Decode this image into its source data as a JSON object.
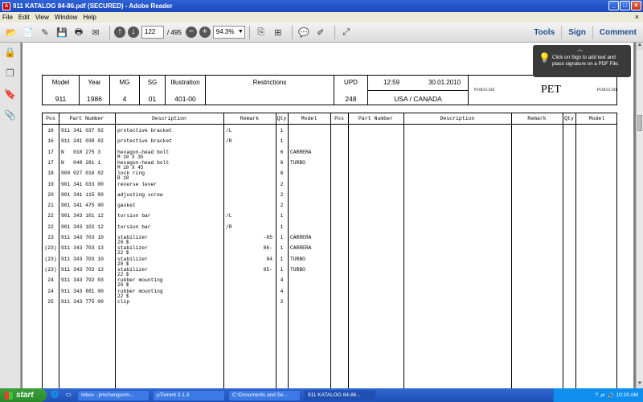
{
  "window": {
    "title": "911 KATALOG 84-86.pdf (SECURED) - Adobe Reader",
    "app_icon_text": "A"
  },
  "menu": [
    "File",
    "Edit",
    "View",
    "Window",
    "Help"
  ],
  "toolbar": {
    "page_current": "122",
    "page_total": "/ 495",
    "zoom": "94.3%",
    "links": [
      "Tools",
      "Sign",
      "Comment"
    ]
  },
  "tooltip": {
    "text": "Click on Sign to add text and place signature on a PDF File."
  },
  "header": {
    "model_label": "Model",
    "model": "911",
    "year_label": "Year",
    "year": "1986",
    "mg_label": "MG",
    "mg": "4",
    "sg_label": "SG",
    "sg": "01",
    "illustration_label": "Illustration",
    "illustration": "401-00",
    "restrictions_label": "Restrictions",
    "upd_label": "UPD",
    "upd": "248",
    "time": "12:59",
    "date": "30.01.2010",
    "market": "USA / CANADA",
    "brand_left": "PORSCHE",
    "brand_center": "PET",
    "brand_right": "PORSCHE"
  },
  "table": {
    "columns": [
      "Pos",
      "Part Number",
      "Description",
      "Remark",
      "Qty",
      "Model"
    ],
    "rows": [
      {
        "pos": "16",
        "part": "911 341 037 02",
        "desc": "protective bracket",
        "sub": "",
        "remark": "/L",
        "qty": "1",
        "model": ""
      },
      {
        "pos": "16",
        "part": "911 341 038 02",
        "desc": "protective bracket",
        "sub": "",
        "remark": "/R",
        "qty": "1",
        "model": ""
      },
      {
        "pos": "17",
        "part": "N   010 275 3",
        "desc": "hexagon-head bolt",
        "sub": "M 10 X 35",
        "remark": "",
        "qty": "6",
        "model": "CARRERA"
      },
      {
        "pos": "17",
        "part": "N   040 281 1",
        "desc": "hexagon-head bolt",
        "sub": "M 10 X 45",
        "remark": "",
        "qty": "6",
        "model": "TURBO"
      },
      {
        "pos": "18",
        "part": "900 027 016 02",
        "desc": "lock ring",
        "sub": "B 10",
        "remark": "",
        "qty": "6",
        "model": ""
      },
      {
        "pos": "19",
        "part": "901 341 033 00",
        "desc": "reverse lever",
        "sub": "",
        "remark": "",
        "qty": "2",
        "model": ""
      },
      {
        "pos": "20",
        "part": "901 341 115 00",
        "desc": "adjusting screw",
        "sub": "",
        "remark": "",
        "qty": "2",
        "model": ""
      },
      {
        "pos": "21",
        "part": "901 341 475 00",
        "desc": "gasket",
        "sub": "",
        "remark": "",
        "qty": "2",
        "model": ""
      },
      {
        "pos": "22",
        "part": "901 343 101 12",
        "desc": "torsion bar",
        "sub": "",
        "remark": "/L",
        "qty": "1",
        "model": ""
      },
      {
        "pos": "22",
        "part": "901 343 102 12",
        "desc": "torsion bar",
        "sub": "",
        "remark": "/R",
        "qty": "1",
        "model": ""
      },
      {
        "pos": "23",
        "part": "911 343 703 10",
        "desc": "stabilizer",
        "sub": "20 $",
        "remark": "-85",
        "qty": "1",
        "model": "CARRERA"
      },
      {
        "pos": "(23)",
        "part": "911 343 703 13",
        "desc": "stabilizer",
        "sub": "22 $",
        "remark": "86-",
        "qty": "1",
        "model": "CARRERA"
      },
      {
        "pos": "(23)",
        "part": "911 343 703 10",
        "desc": "stabilizer",
        "sub": "20 $",
        "remark": "84",
        "qty": "1",
        "model": "TURBO"
      },
      {
        "pos": "(23)",
        "part": "911 343 703 13",
        "desc": "stabilizer",
        "sub": "22 $",
        "remark": "85-",
        "qty": "1",
        "model": "TURBO"
      },
      {
        "pos": "24",
        "part": "911 343 792 03",
        "desc": "rubber mounting",
        "sub": "20 $",
        "remark": "",
        "qty": "4",
        "model": ""
      },
      {
        "pos": "24",
        "part": "911 343 881 00",
        "desc": "rubber mounting",
        "sub": "22 $",
        "remark": "",
        "qty": "4",
        "model": ""
      },
      {
        "pos": "25",
        "part": "911 343 775 00",
        "desc": "clip",
        "sub": "",
        "remark": "",
        "qty": "2",
        "model": ""
      }
    ]
  },
  "taskbar": {
    "start": "start",
    "tasks": [
      "Inbox - jimchangcom...",
      "µTorrent 3.1.3",
      "C:\\Documents and Se...",
      "911 KATALOG 84-86..."
    ],
    "clock": "10:19 AM"
  },
  "colors": {
    "titlebar": "#1a47b8",
    "link": "#1d4f8d",
    "tooltip_bg": "#3a3a3a"
  }
}
